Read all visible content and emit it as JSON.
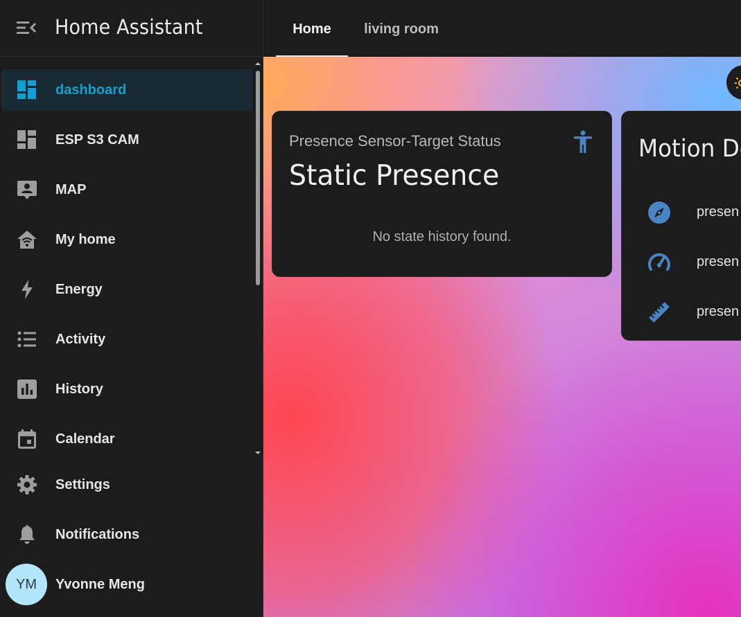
{
  "app": {
    "title": "Home Assistant"
  },
  "sidebar": {
    "items": [
      {
        "label": "dashboard",
        "icon": "view-dashboard-icon",
        "active": true
      },
      {
        "label": "ESP S3 CAM",
        "icon": "view-dashboard-icon"
      },
      {
        "label": "MAP",
        "icon": "map-account-icon"
      },
      {
        "label": "My home",
        "icon": "home-wifi-icon"
      },
      {
        "label": "Energy",
        "icon": "lightning-bolt-icon"
      },
      {
        "label": "Activity",
        "icon": "format-list-icon"
      },
      {
        "label": "History",
        "icon": "chart-box-icon"
      },
      {
        "label": "Calendar",
        "icon": "calendar-icon"
      }
    ],
    "bottom": {
      "settings": "Settings",
      "notifications": "Notifications",
      "user_initials": "YM",
      "user_name": "Yvonne Meng"
    }
  },
  "tabs": [
    {
      "label": "Home",
      "active": true
    },
    {
      "label": "living room",
      "active": false
    }
  ],
  "cards": {
    "presence": {
      "name": "Presence Sensor-Target Status",
      "state": "Static Presence",
      "history": "No state history found.",
      "icon": "human-icon"
    },
    "motion": {
      "title": "Motion De",
      "entities": [
        {
          "label": "presen",
          "icon": "compass-icon"
        },
        {
          "label": "presen",
          "icon": "speedometer-icon"
        },
        {
          "label": "presen",
          "icon": "ruler-icon"
        }
      ]
    }
  },
  "colors": {
    "accent": "#0fa0d6",
    "active_bg": "#1a2a32",
    "icon_blue": "#4a84c4",
    "sidebar_bg": "#1c1c1c",
    "avatar_bg": "#b3e5fc",
    "sun": "#f5c518"
  }
}
